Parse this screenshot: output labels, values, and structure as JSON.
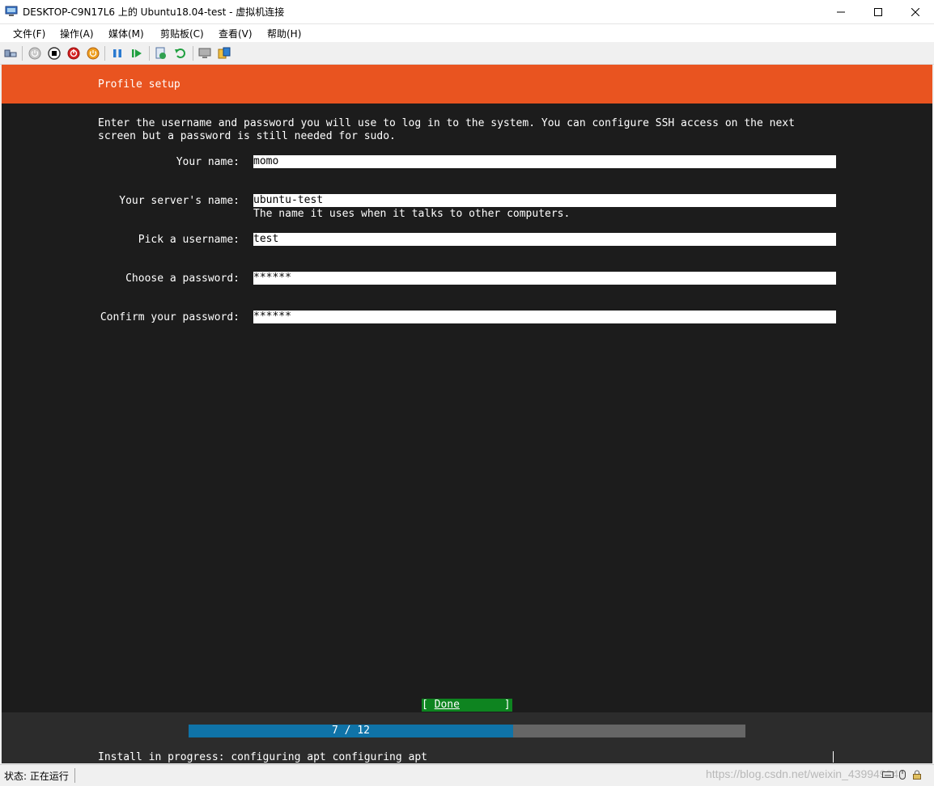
{
  "window": {
    "title": "DESKTOP-C9N17L6 上的 Ubuntu18.04-test - 虚拟机连接"
  },
  "menu": {
    "items": [
      "文件(F)",
      "操作(A)",
      "媒体(M)",
      "剪贴板(C)",
      "查看(V)",
      "帮助(H)"
    ]
  },
  "toolbar": {
    "icons": [
      "ctrl-alt-del-icon",
      "start-icon",
      "turn-off-icon",
      "shutdown-icon",
      "save-icon",
      "pause-icon",
      "resume-icon",
      "checkpoint-icon",
      "revert-icon",
      "enhanced-session-icon",
      "share-icon"
    ]
  },
  "installer": {
    "header": "Profile setup",
    "intro_line1": "Enter the username and password you will use to log in to the system. You can configure SSH access on the next",
    "intro_line2": "screen but a password is still needed for sudo.",
    "fields": {
      "name": {
        "label": "Your name:",
        "value": "momo"
      },
      "server": {
        "label": "Your server's name:",
        "value": "ubuntu-test",
        "help": "The name it uses when it talks to other computers."
      },
      "username": {
        "label": "Pick a username:",
        "value": "test"
      },
      "password": {
        "label": "Choose a password:",
        "value": "******"
      },
      "confirm": {
        "label": "Confirm your password:",
        "value": "******"
      }
    },
    "done_open": "[ ",
    "done_label": "Done",
    "done_close": "       ]",
    "progress": {
      "text": "7 / 12",
      "current": 7,
      "total": 12
    },
    "status_line": "Install in progress: configuring apt configuring apt"
  },
  "statusbar": {
    "state": "状态: 正在运行",
    "watermark": "https://blog.csdn.net/weixin_43994994"
  },
  "colors": {
    "ubuntu_orange": "#e95420",
    "console_bg": "#1c1c1c",
    "done_green": "#0e8420",
    "progress_blue": "#0f73a8"
  }
}
